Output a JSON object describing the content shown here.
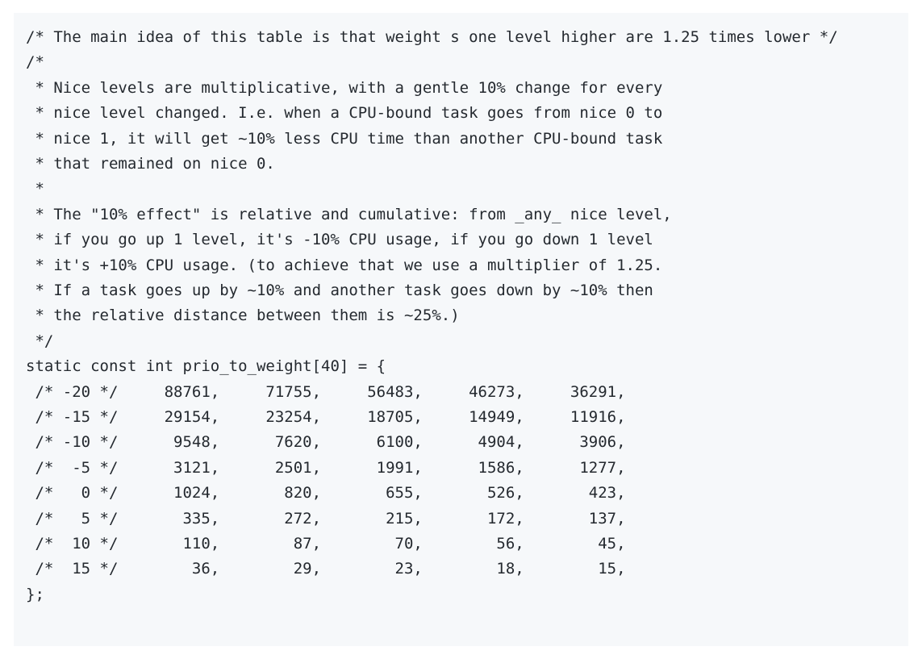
{
  "code": {
    "lines": [
      "/* The main idea of this table is that weight s one level higher are 1.25 times lower */",
      "/*",
      " * Nice levels are multiplicative, with a gentle 10% change for every",
      " * nice level changed. I.e. when a CPU-bound task goes from nice 0 to",
      " * nice 1, it will get ~10% less CPU time than another CPU-bound task",
      " * that remained on nice 0.",
      " *",
      " * The \"10% effect\" is relative and cumulative: from _any_ nice level,",
      " * if you go up 1 level, it's -10% CPU usage, if you go down 1 level",
      " * it's +10% CPU usage. (to achieve that we use a multiplier of 1.25.",
      " * If a task goes up by ~10% and another task goes down by ~10% then",
      " * the relative distance between them is ~25%.)",
      " */",
      "static const int prio_to_weight[40] = {",
      " /* -20 */     88761,     71755,     56483,     46273,     36291,",
      " /* -15 */     29154,     23254,     18705,     14949,     11916,",
      " /* -10 */      9548,      7620,      6100,      4904,      3906,",
      " /*  -5 */      3121,      2501,      1991,      1586,      1277,",
      " /*   0 */      1024,       820,       655,       526,       423,",
      " /*   5 */       335,       272,       215,       172,       137,",
      " /*  10 */       110,        87,        70,        56,        45,",
      " /*  15 */        36,        29,        23,        18,        15,",
      "};"
    ]
  }
}
